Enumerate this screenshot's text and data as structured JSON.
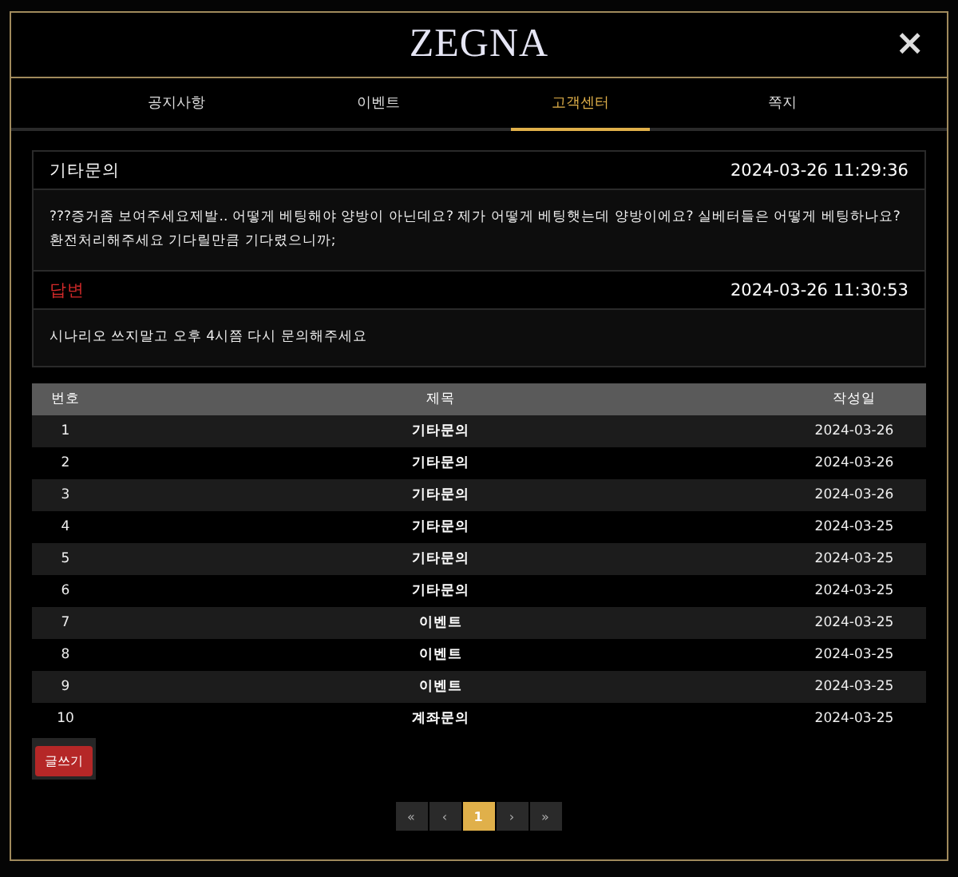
{
  "modal": {
    "logo": "ZEGNA",
    "close": "×"
  },
  "tabs": [
    {
      "label": "공지사항",
      "selected": false
    },
    {
      "label": "이벤트",
      "selected": false
    },
    {
      "label": "고객센터",
      "selected": true
    },
    {
      "label": "쪽지",
      "selected": false
    }
  ],
  "inquiry": {
    "title": "기타문의",
    "time": "2024-03-26 11:29:36",
    "body": "???증거좀 보여주세요제발.. 어떻게 베팅해야 양방이 아닌데요? 제가 어떻게 베팅햇는데 양방이에요? 실베터들은 어떻게 베팅하나요? 환전처리해주세요 기다릴만큼 기다렸으니까;"
  },
  "answer": {
    "title": "답변",
    "time": "2024-03-26 11:30:53",
    "body": "시나리오 쓰지말고 오후 4시쯤 다시 문의해주세요"
  },
  "table": {
    "columns": [
      "번호",
      "제목",
      "작성일"
    ],
    "rows": [
      [
        "1",
        "기타문의",
        "2024-03-26"
      ],
      [
        "2",
        "기타문의",
        "2024-03-26"
      ],
      [
        "3",
        "기타문의",
        "2024-03-26"
      ],
      [
        "4",
        "기타문의",
        "2024-03-25"
      ],
      [
        "5",
        "기타문의",
        "2024-03-25"
      ],
      [
        "6",
        "기타문의",
        "2024-03-25"
      ],
      [
        "7",
        "이벤트",
        "2024-03-25"
      ],
      [
        "8",
        "이벤트",
        "2024-03-25"
      ],
      [
        "9",
        "이벤트",
        "2024-03-25"
      ],
      [
        "10",
        "계좌문의",
        "2024-03-25"
      ]
    ]
  },
  "write_button": "글쓰기",
  "pagination": [
    {
      "label": "«",
      "selected": false
    },
    {
      "label": "‹",
      "selected": false
    },
    {
      "label": "1",
      "selected": true
    },
    {
      "label": "›",
      "selected": false
    },
    {
      "label": "»",
      "selected": false
    }
  ]
}
